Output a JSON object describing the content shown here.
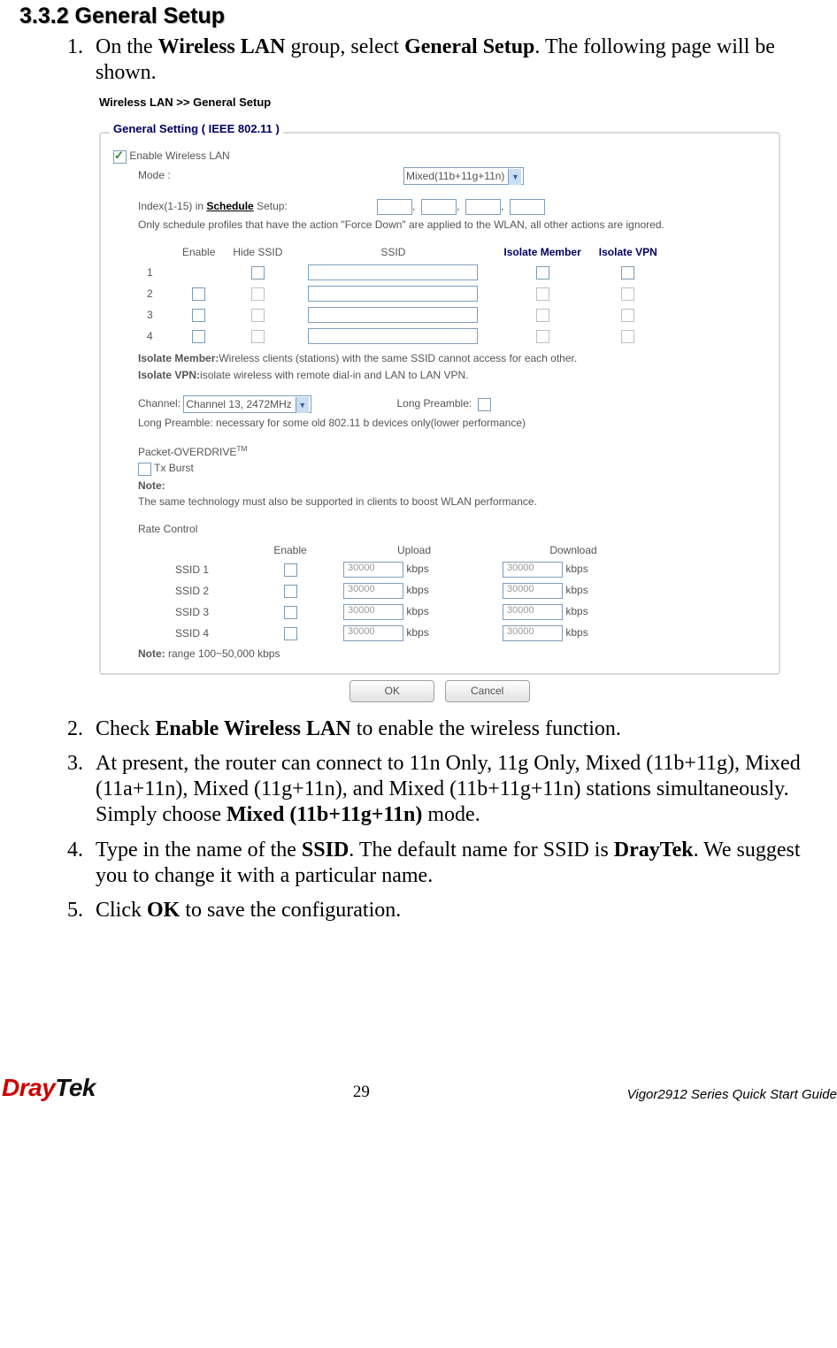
{
  "heading": "3.3.2 General Setup",
  "steps": {
    "s1a": "On the ",
    "s1b": "Wireless LAN",
    "s1c": " group, select ",
    "s1d": "General Setup",
    "s1e": ". The following page will be shown.",
    "s2a": "Check ",
    "s2b": "Enable Wireless LAN",
    "s2c": " to enable the wireless function.",
    "s3a": "At present, the router can connect to 11n Only, 11g Only, Mixed (11b+11g), Mixed (11a+11n), Mixed (11g+11n), and Mixed (11b+11g+11n) stations simultaneously. Simply choose ",
    "s3b": "Mixed (11b+11g+11n)",
    "s3c": " mode.",
    "s4a": "Type in the name of the ",
    "s4b": "SSID",
    "s4c": ". The default name for SSID is ",
    "s4d": "DrayTek",
    "s4e": ". We suggest you to change it with a particular name.",
    "s5a": "Click ",
    "s5b": "OK",
    "s5c": " to save the configuration."
  },
  "shot": {
    "breadcrumb": "Wireless LAN >> General Setup",
    "panel_title": "General Setting ( IEEE 802.11 )",
    "enable_wlan": "Enable Wireless LAN",
    "mode_label": "Mode :",
    "mode_value": "Mixed(11b+11g+11n)",
    "schedule_a": "Index(1-15) in  ",
    "schedule_link": "Schedule",
    "schedule_b": " Setup:",
    "schedule_note": "Only schedule profiles that have the action \"Force Down\" are applied to the WLAN, all other actions are ignored.",
    "col_enable": "Enable",
    "col_hide": "Hide SSID",
    "col_ssid": "SSID",
    "col_isomem": "Isolate Member",
    "col_isovpn": "Isolate VPN",
    "r1": "1",
    "r2": "2",
    "r3": "3",
    "r4": "4",
    "iso_mem_lbl": "Isolate Member:",
    "iso_mem_txt": "Wireless clients (stations) with the same SSID cannot access for each other.",
    "iso_vpn_lbl": "Isolate VPN:",
    "iso_vpn_txt": "isolate wireless with remote dial-in and LAN to LAN VPN.",
    "channel_lbl": "Channel:",
    "channel_val": "Channel 13, 2472MHz",
    "longp_lbl": "Long Preamble:",
    "longp_note": "Long Preamble: necessary for some old 802.11 b devices only(lower performance)",
    "packet_od": "Packet-OVERDRIVE",
    "txburst": "Tx Burst",
    "note_lbl": "Note:",
    "note_txt": "The same technology must also be supported in clients to boost WLAN performance.",
    "rate_ctrl": "Rate Control",
    "rc_enable": "Enable",
    "rc_upload": "Upload",
    "rc_download": "Download",
    "ssid1": "SSID 1",
    "ssid2": "SSID 2",
    "ssid3": "SSID 3",
    "ssid4": "SSID 4",
    "rate_val": "30000",
    "kbps": "kbps",
    "rate_note_lbl": "Note:",
    "rate_note": " range 100~50,000 kbps",
    "ok": "OK",
    "cancel": "Cancel"
  },
  "footer": {
    "pagenum": "29",
    "guide": "Vigor2912 Series Quick Start Guide",
    "logo1": "Dray",
    "logo2": "Tek"
  }
}
